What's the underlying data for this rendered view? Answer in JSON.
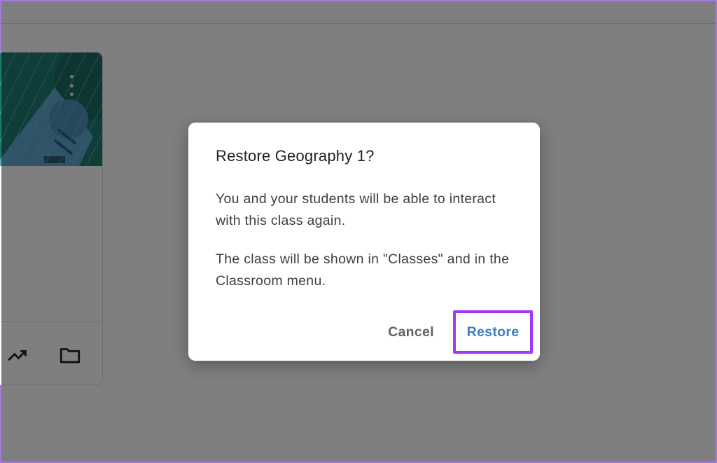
{
  "dialog": {
    "title": "Restore Geography 1?",
    "paragraph_1": "You and your students will be able to interact with this class again.",
    "paragraph_2": "The class will be shown in \"Classes\" and in the Classroom menu.",
    "cancel_label": "Cancel",
    "restore_label": "Restore"
  },
  "card": {
    "menu_icon": "more-vert-icon",
    "icons": [
      "trending-up-icon",
      "folder-icon"
    ]
  },
  "colors": {
    "banner": "#1f7b73",
    "highlight": "#a338f5",
    "restore_text": "#3e7dbf"
  }
}
